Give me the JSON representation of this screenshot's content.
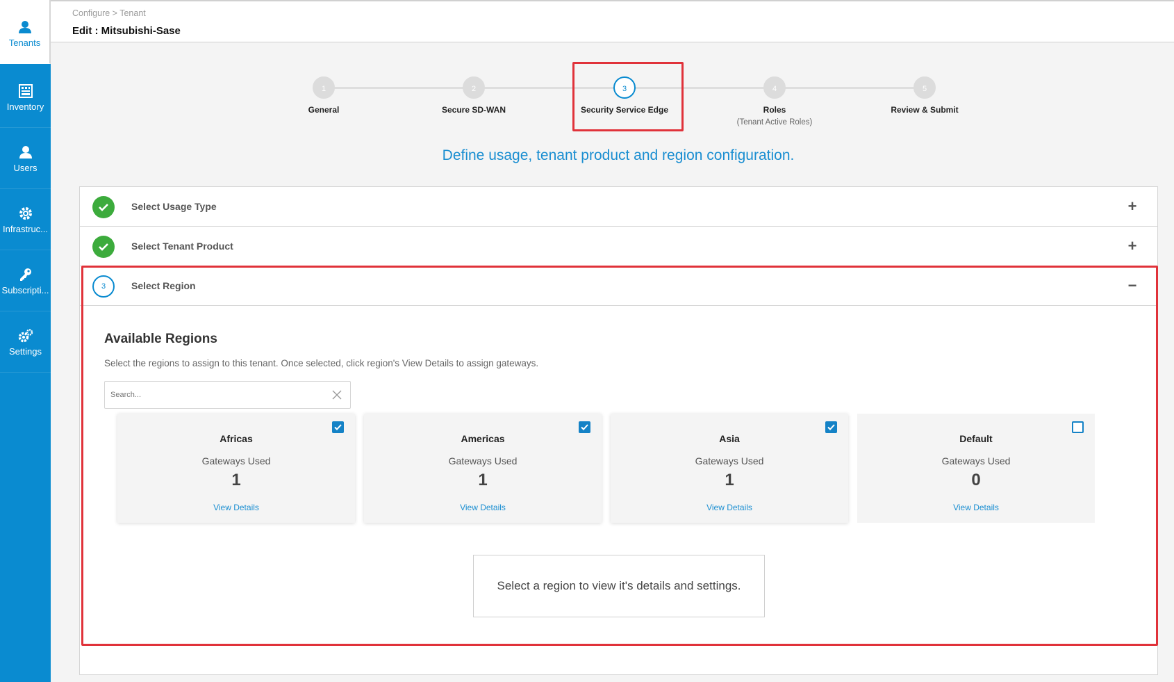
{
  "sidebar": {
    "items": [
      {
        "label": "Tenants",
        "icon": "tenants-icon",
        "active": true
      },
      {
        "label": "Inventory",
        "icon": "inventory-icon",
        "active": false
      },
      {
        "label": "Users",
        "icon": "users-icon",
        "active": false
      },
      {
        "label": "Infrastruc...",
        "icon": "infrastructure-icon",
        "active": false
      },
      {
        "label": "Subscripti...",
        "icon": "key-icon",
        "active": false
      },
      {
        "label": "Settings",
        "icon": "settings-icon",
        "active": false
      }
    ]
  },
  "header": {
    "breadcrumb": "Configure > Tenant",
    "title": "Edit : Mitsubishi-Sase"
  },
  "stepper": {
    "steps": [
      {
        "number": "1",
        "label": "General",
        "sub": ""
      },
      {
        "number": "2",
        "label": "Secure SD-WAN",
        "sub": ""
      },
      {
        "number": "3",
        "label": "Security Service Edge",
        "sub": ""
      },
      {
        "number": "4",
        "label": "Roles",
        "sub": "(Tenant Active Roles)"
      },
      {
        "number": "5",
        "label": "Review & Submit",
        "sub": ""
      }
    ],
    "active_step": 3
  },
  "subtitle": "Define usage, tenant product and region configuration.",
  "accordion": {
    "sections": [
      {
        "label": "Select Usage Type",
        "status": "complete",
        "toggle": "+"
      },
      {
        "label": "Select Tenant Product",
        "status": "complete",
        "toggle": "+"
      },
      {
        "label": "Select Region",
        "status": "active",
        "number": "3",
        "toggle": "−"
      }
    ]
  },
  "regions": {
    "title": "Available Regions",
    "description": "Select the regions to assign to this tenant. Once selected, click region's View Details to assign gateways.",
    "search_placeholder": "Search...",
    "cards": [
      {
        "name": "Africas",
        "gateways_label": "Gateways Used",
        "count": "1",
        "link": "View Details",
        "checked": true
      },
      {
        "name": "Americas",
        "gateways_label": "Gateways Used",
        "count": "1",
        "link": "View Details",
        "checked": true
      },
      {
        "name": "Asia",
        "gateways_label": "Gateways Used",
        "count": "1",
        "link": "View Details",
        "checked": true
      },
      {
        "name": "Default",
        "gateways_label": "Gateways Used",
        "count": "0",
        "link": "View Details",
        "checked": false
      }
    ],
    "empty_message": "Select a region to view it's details and settings."
  },
  "colors": {
    "sidebar": "#0a8bd0",
    "accent": "#1a8ed1",
    "success": "#3cab3c",
    "highlight": "#e0323a"
  }
}
